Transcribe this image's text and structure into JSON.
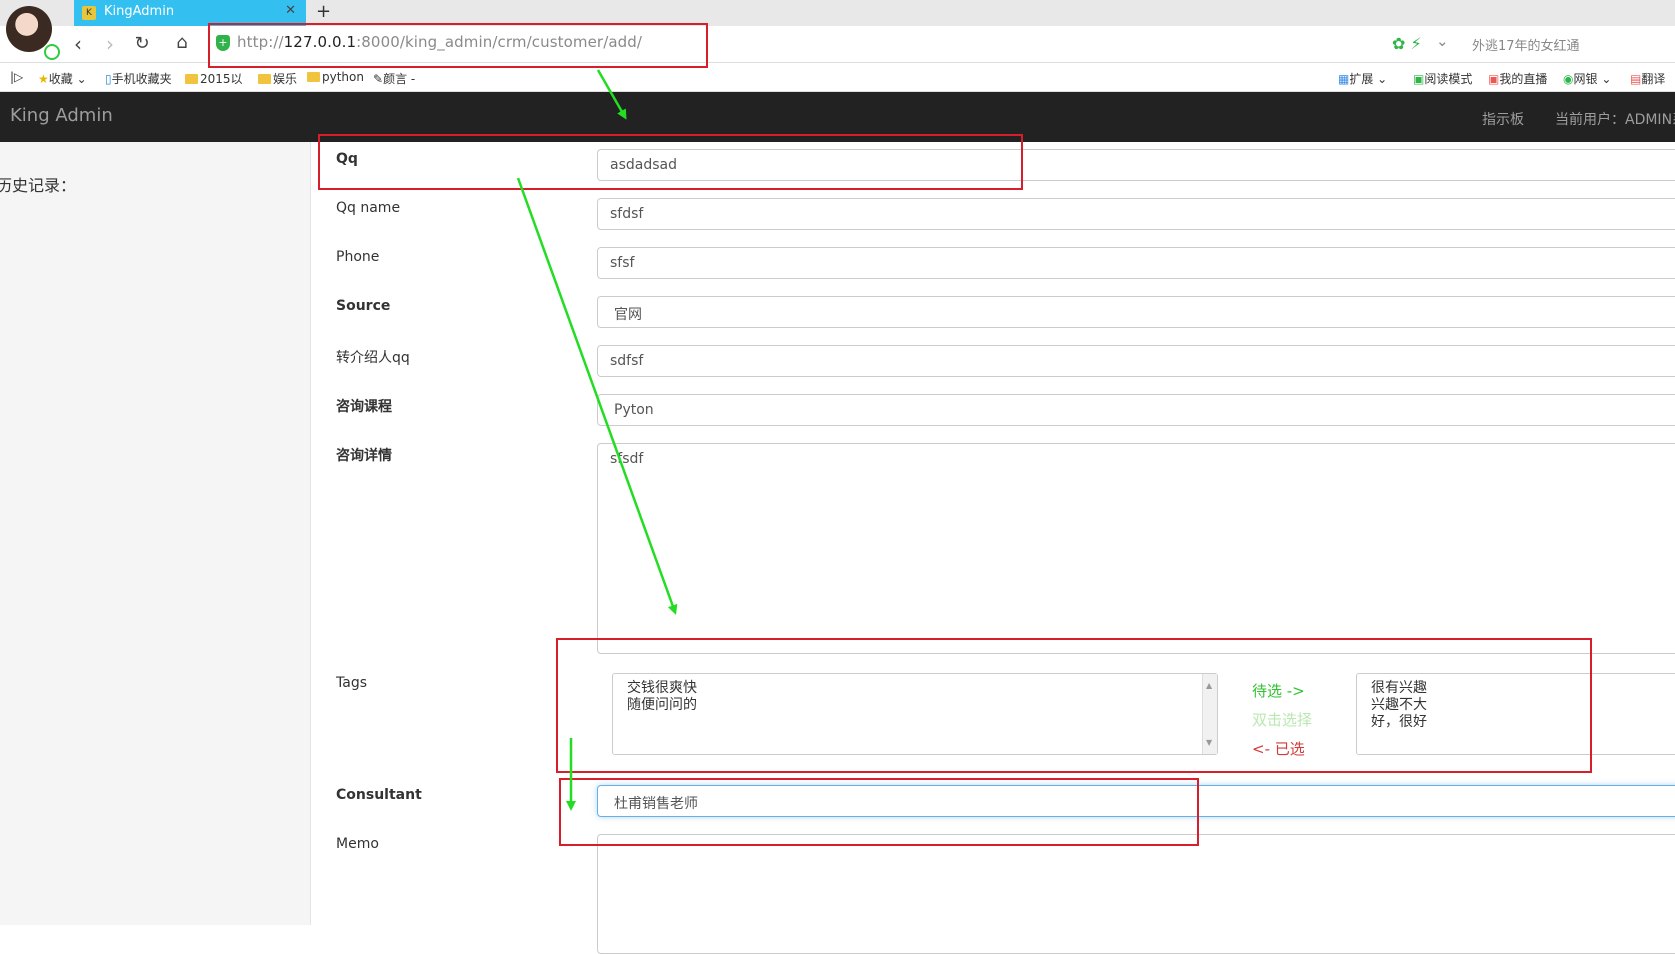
{
  "browser": {
    "tab_title": "KingAdmin",
    "tab_icon": "kingadmin-favicon",
    "url_prefix": "http://",
    "url_host": "127.0.0.1",
    "url_path": ":8000/king_admin/crm/customer/add/",
    "search_hint": "外逃17年的女红通",
    "bookmarks": [
      "收藏",
      "手机收藏夹",
      "2015以",
      "娱乐",
      "python",
      "颜言 -"
    ],
    "right_tools": [
      "扩展",
      "阅读模式",
      "我的直播",
      "网银",
      "翻译"
    ]
  },
  "navbar": {
    "brand": "King Admin",
    "dashboard": "指示板",
    "current_user": "当前用户：ADMIN系"
  },
  "sidebar": {
    "history_label": "历史记录："
  },
  "form": {
    "qq": {
      "label": "Qq",
      "value": "asdadsad"
    },
    "qq_name": {
      "label": "Qq name",
      "value": "sfdsf"
    },
    "phone": {
      "label": "Phone",
      "value": "sfsf"
    },
    "source": {
      "label": "Source",
      "value": "官网"
    },
    "referral_qq": {
      "label": "转介绍人qq",
      "value": "sdfsf"
    },
    "course": {
      "label": "咨询课程",
      "value": "Pyton"
    },
    "details": {
      "label": "咨询详情",
      "value": "sfsdf"
    },
    "tags": {
      "label": "Tags",
      "available": [
        "交钱很爽快",
        "随便问问的"
      ],
      "selected": [
        "很有兴趣",
        "兴趣不大",
        "好，很好"
      ],
      "available_caption": "待选 ->",
      "hint": "双击选择",
      "selected_caption": "<- 已选"
    },
    "consultant": {
      "label": "Consultant",
      "value": "杜甫销售老师"
    },
    "memo": {
      "label": "Memo",
      "value": ""
    }
  },
  "colors": {
    "annotation_box": "#d61f2b",
    "annotation_arrow": "#22dd22",
    "navbar_bg": "#222222"
  }
}
